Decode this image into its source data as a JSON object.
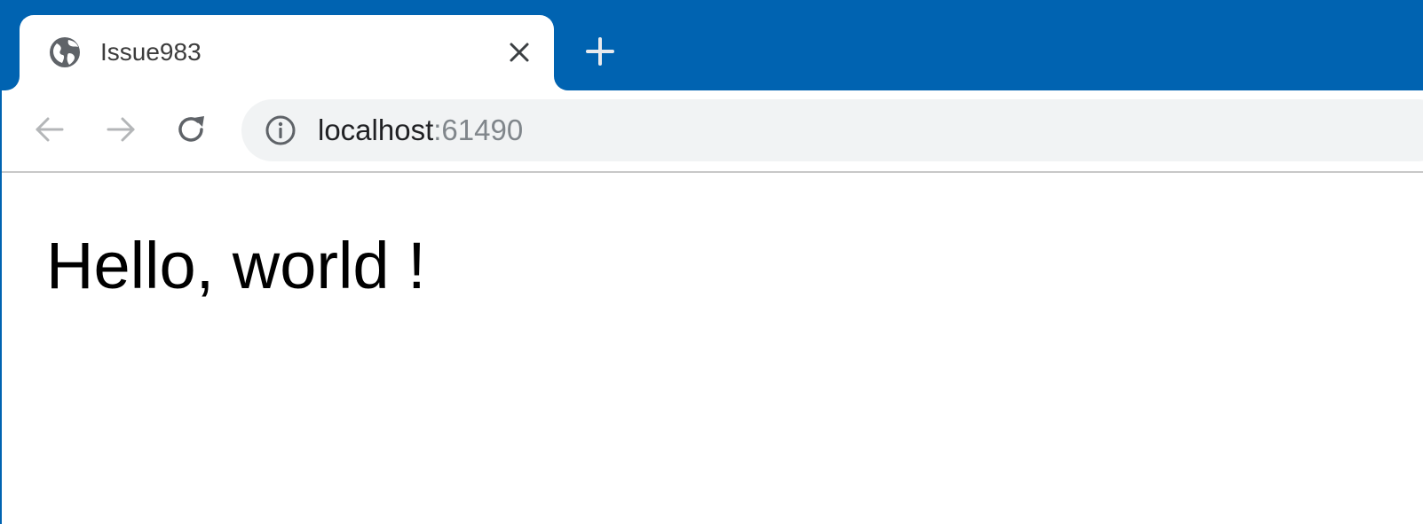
{
  "browser": {
    "tab": {
      "title": "Issue983",
      "favicon": "globe-icon",
      "close_icon": "close-icon"
    },
    "new_tab_icon": "plus-icon",
    "toolbar": {
      "back_icon": "arrow-left-icon",
      "forward_icon": "arrow-right-icon",
      "reload_icon": "reload-icon",
      "site_info_icon": "info-icon",
      "url": {
        "host": "localhost",
        "port": ":61490"
      }
    },
    "colors": {
      "tabstrip": "#0063b1",
      "omnibox": "#f1f3f4",
      "url_host": "#202124",
      "url_port": "#80868b"
    }
  },
  "page": {
    "heading": "Hello, world !"
  }
}
